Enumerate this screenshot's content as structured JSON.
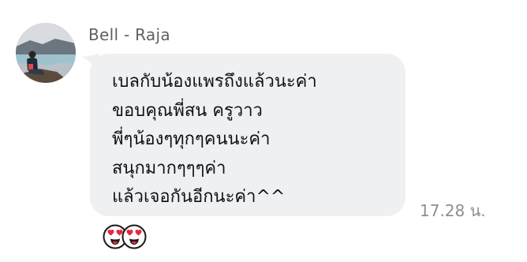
{
  "message": {
    "sender": "Bell - Raja",
    "lines": [
      "เบลกับน้องแพรถึงแล้วนะค่า",
      "ขอบคุณพี่สน ครูวาว",
      "พี่ๆน้องๆทุกๆคนนะค่า",
      "สนุกมากๆๆๆค่า",
      "แล้วเจอกันอีกนะค่า^^"
    ],
    "time": "17.28 น."
  },
  "reactions": [
    {
      "icon": "heart-eyes-face-icon"
    },
    {
      "icon": "heart-eyes-face-icon"
    }
  ],
  "colors": {
    "bubble": "#eef0f2",
    "text": "#111111",
    "sender": "#5f6064",
    "timestamp": "#8d8f93",
    "reaction_heart": "#e8263c"
  }
}
